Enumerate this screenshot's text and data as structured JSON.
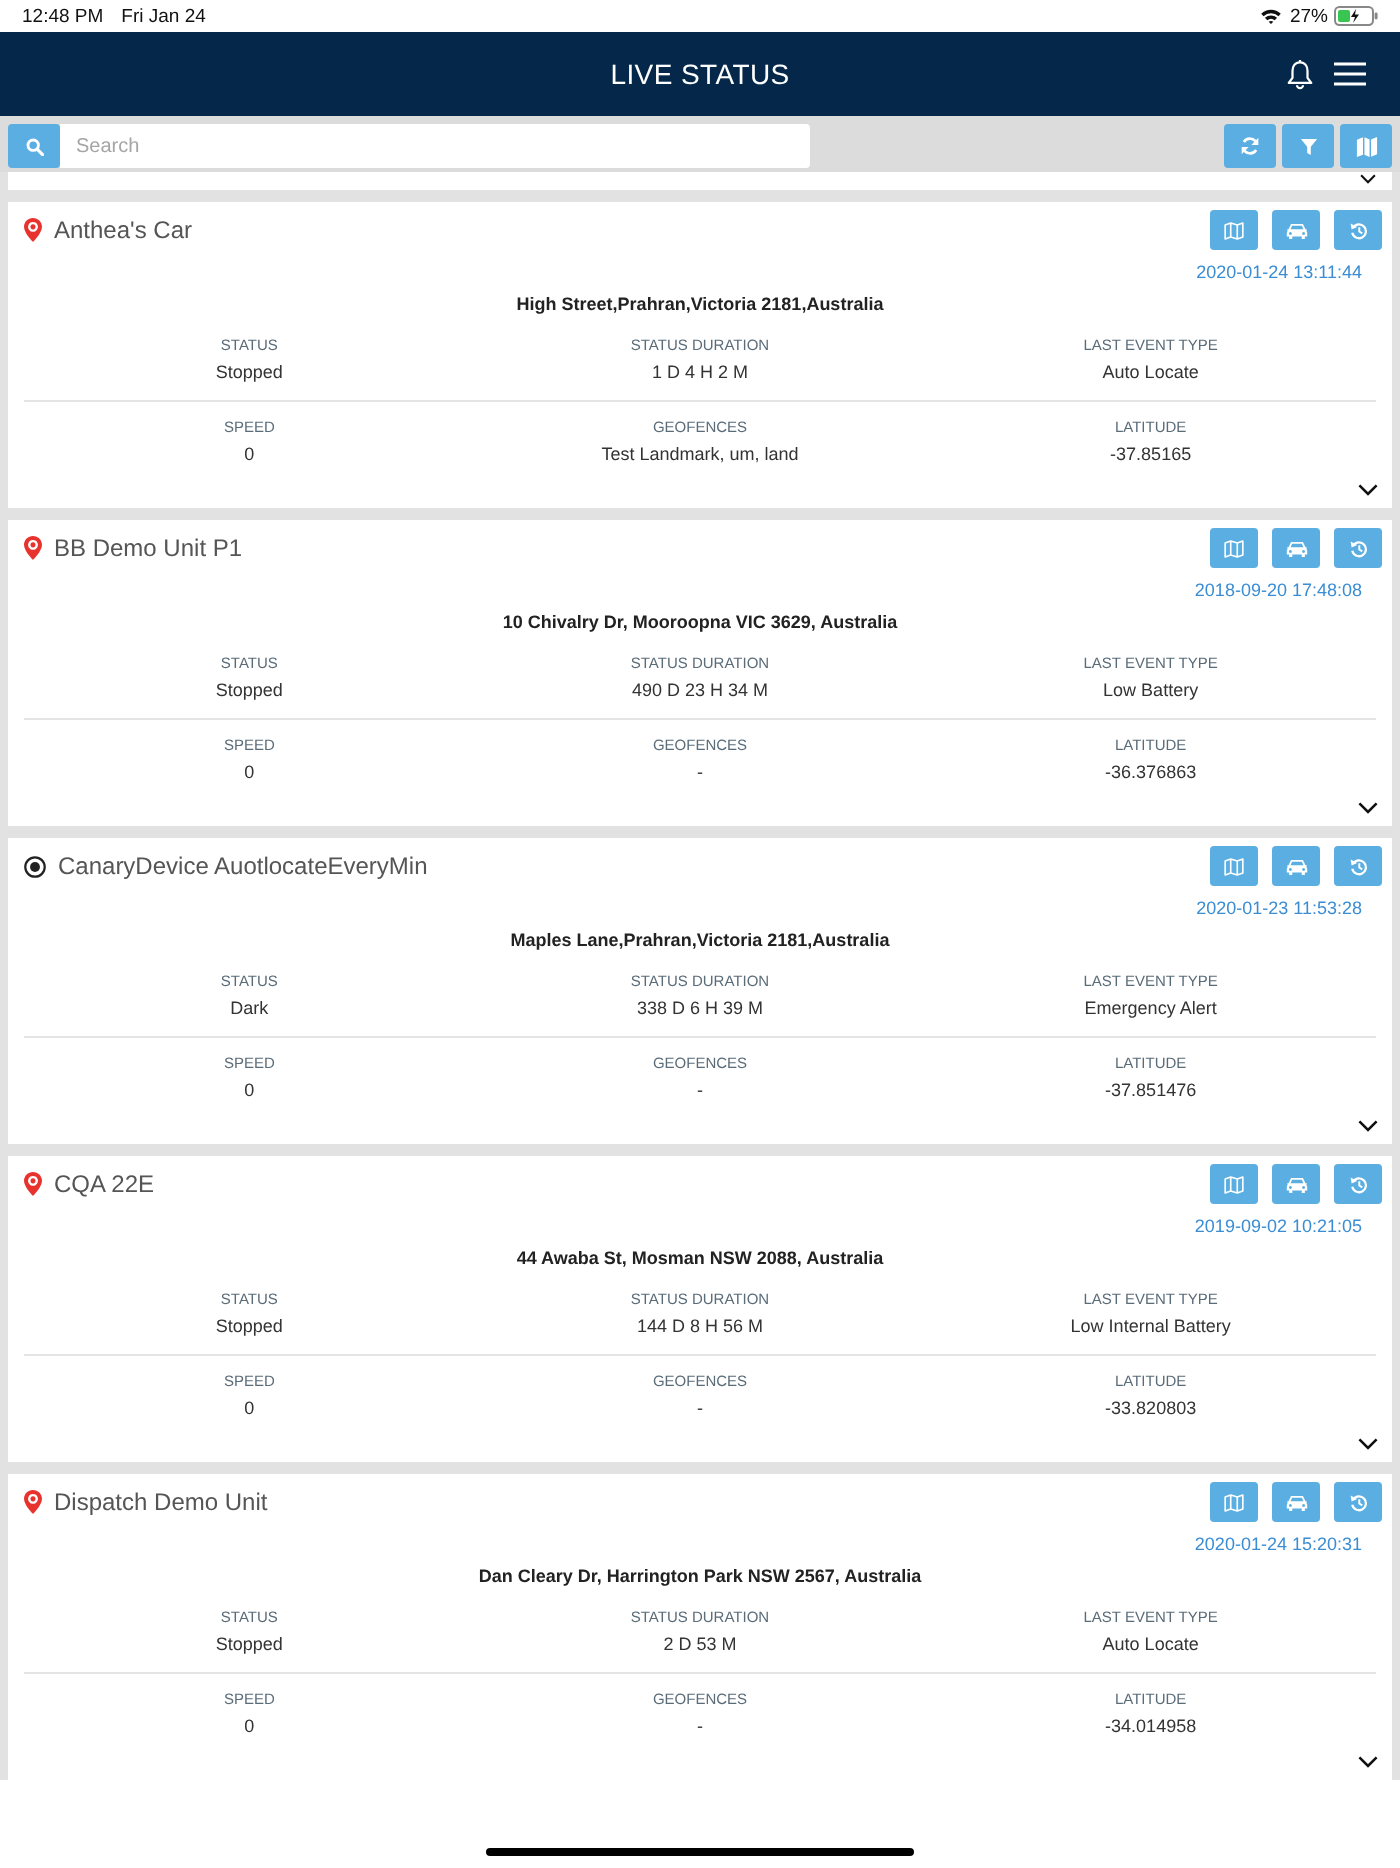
{
  "status_bar": {
    "time": "12:48 PM",
    "date": "Fri Jan 24",
    "battery": "27%"
  },
  "header": {
    "title": "LIVE STATUS"
  },
  "toolbar": {
    "search": {
      "placeholder": "Search"
    }
  },
  "partial_card_above": {
    "expanded": false
  },
  "devices": [
    {
      "name": "Anthea's Car",
      "kind": "pin",
      "timestamp": "2020-01-24 13:11:44",
      "address": "High Street,Prahran,Victoria 2181,Australia",
      "fields": [
        {
          "label": "STATUS",
          "value": "Stopped"
        },
        {
          "label": "STATUS DURATION",
          "value": "1 D 4 H 2 M"
        },
        {
          "label": "LAST EVENT TYPE",
          "value": "Auto Locate"
        },
        {
          "label": "SPEED",
          "value": "0"
        },
        {
          "label": "GEOFENCES",
          "value": "Test Landmark, um, land"
        },
        {
          "label": "LATITUDE",
          "value": "-37.85165"
        }
      ],
      "expanded": false
    },
    {
      "name": "BB Demo Unit P1",
      "kind": "pin",
      "timestamp": "2018-09-20 17:48:08",
      "address": "10 Chivalry Dr, Mooroopna VIC 3629, Australia",
      "fields": [
        {
          "label": "STATUS",
          "value": "Stopped"
        },
        {
          "label": "STATUS DURATION",
          "value": "490 D 23 H 34 M"
        },
        {
          "label": "LAST EVENT TYPE",
          "value": "Low Battery"
        },
        {
          "label": "SPEED",
          "value": "0"
        },
        {
          "label": "GEOFENCES",
          "value": "-"
        },
        {
          "label": "LATITUDE",
          "value": "-36.376863"
        }
      ],
      "expanded": false
    },
    {
      "name": "CanaryDevice AuotlocateEveryMin",
      "kind": "ring",
      "timestamp": "2020-01-23 11:53:28",
      "address": "Maples Lane,Prahran,Victoria 2181,Australia",
      "fields": [
        {
          "label": "STATUS",
          "value": "Dark"
        },
        {
          "label": "STATUS DURATION",
          "value": "338 D 6 H 39 M"
        },
        {
          "label": "LAST EVENT TYPE",
          "value": "Emergency Alert"
        },
        {
          "label": "SPEED",
          "value": "0"
        },
        {
          "label": "GEOFENCES",
          "value": "-"
        },
        {
          "label": "LATITUDE",
          "value": "-37.851476"
        }
      ],
      "expanded": false
    },
    {
      "name": "CQA 22E",
      "kind": "pin",
      "timestamp": "2019-09-02 10:21:05",
      "address": "44 Awaba St, Mosman NSW 2088, Australia",
      "fields": [
        {
          "label": "STATUS",
          "value": "Stopped"
        },
        {
          "label": "STATUS DURATION",
          "value": "144 D 8 H 56 M"
        },
        {
          "label": "LAST EVENT TYPE",
          "value": "Low Internal Battery"
        },
        {
          "label": "SPEED",
          "value": "0"
        },
        {
          "label": "GEOFENCES",
          "value": "-"
        },
        {
          "label": "LATITUDE",
          "value": "-33.820803"
        }
      ],
      "expanded": false
    },
    {
      "name": "Dispatch Demo Unit",
      "kind": "pin",
      "timestamp": "2020-01-24 15:20:31",
      "address": "Dan Cleary Dr, Harrington Park NSW 2567, Australia",
      "fields": [
        {
          "label": "STATUS",
          "value": "Stopped"
        },
        {
          "label": "STATUS DURATION",
          "value": "2 D 53 M"
        },
        {
          "label": "LAST EVENT TYPE",
          "value": "Auto Locate"
        },
        {
          "label": "SPEED",
          "value": "0"
        },
        {
          "label": "GEOFENCES",
          "value": "-"
        },
        {
          "label": "LATITUDE",
          "value": "-34.014958"
        }
      ],
      "expanded": false
    }
  ]
}
